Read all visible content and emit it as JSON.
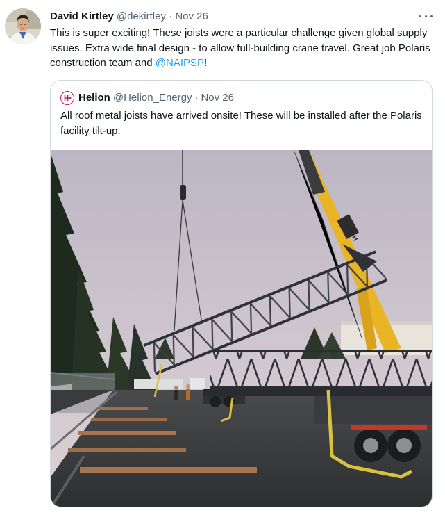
{
  "tweet": {
    "author_name": "David Kirtley",
    "author_handle": "@dekirtley",
    "separator": "·",
    "date": "Nov 26",
    "text_before_mention": "This is super exciting! These joists were a particular challenge given global supply issues. Extra wide final design - to allow full-building crane travel. Great job Polaris construction team and ",
    "mention": "@NAIPSP",
    "text_after_mention": "!"
  },
  "quoted_tweet": {
    "author_name": "Helion",
    "author_handle": "@Helion_Energy",
    "separator": "·",
    "date": "Nov 26",
    "text": "All roof metal joists have arrived onsite! These will be installed after the Polaris facility tilt-up.",
    "crane_lettering": "BARNH"
  },
  "colors": {
    "text_primary": "#0f1419",
    "text_secondary": "#536471",
    "mention_blue": "#1d9bf0",
    "border": "#cfd9de",
    "helion_logo": "#c2185b",
    "crane_yellow": "#e9b425"
  },
  "icons": {
    "more": "more-horizontal-icon",
    "helion_logo": "helion-logo-icon"
  }
}
